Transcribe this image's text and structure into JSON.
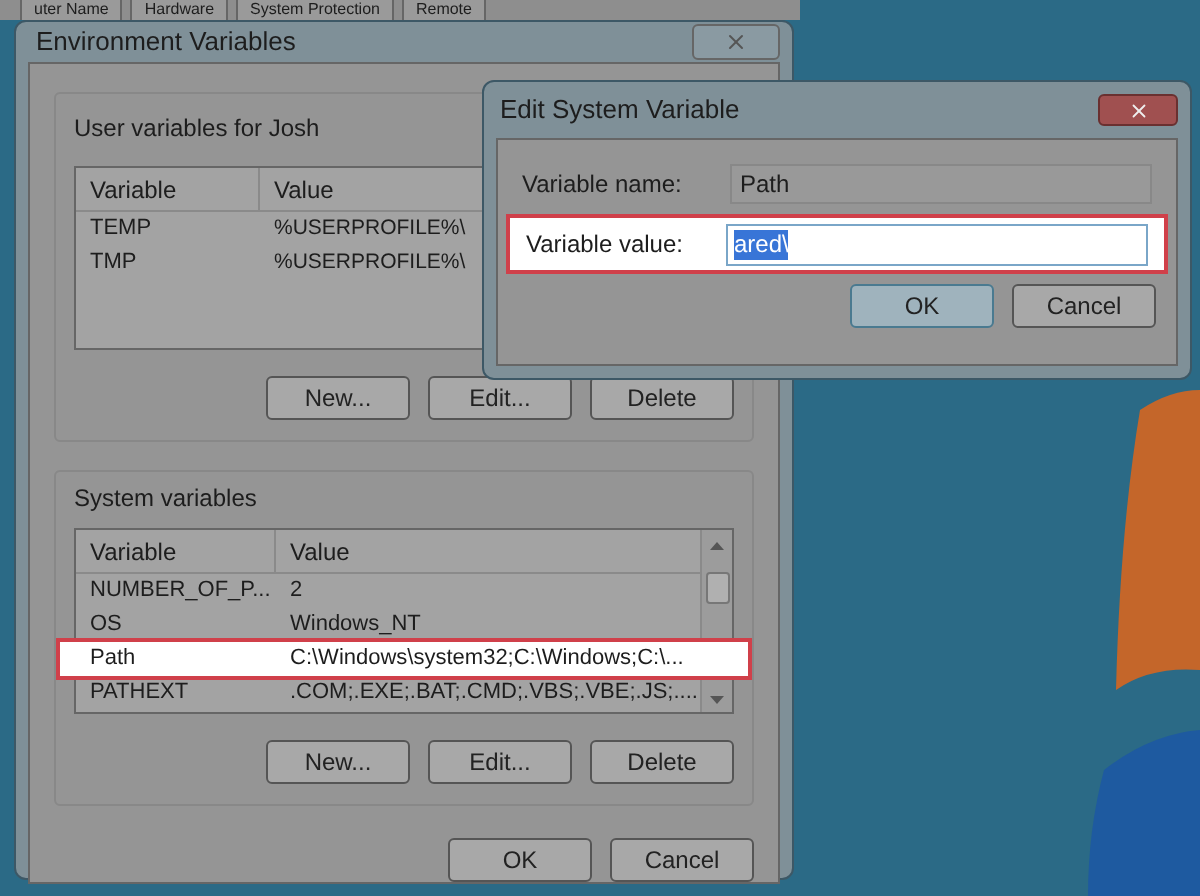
{
  "background_tabs": [
    {
      "label": "uter Name",
      "selected": false
    },
    {
      "label": "Hardware",
      "selected": false
    },
    {
      "label": "System Protection",
      "selected": false
    },
    {
      "label": "Remote",
      "selected": false
    }
  ],
  "environment_window": {
    "title": "Environment Variables",
    "user_group": {
      "label": "User variables for Josh",
      "columns": [
        "Variable",
        "Value"
      ],
      "rows": [
        {
          "variable": "TEMP",
          "value": "%USERPROFILE%\\",
          "selected": false
        },
        {
          "variable": "TMP",
          "value": "%USERPROFILE%\\",
          "selected": false
        }
      ],
      "buttons": [
        "New...",
        "Edit...",
        "Delete"
      ]
    },
    "system_group": {
      "label": "System variables",
      "columns": [
        "Variable",
        "Value"
      ],
      "rows": [
        {
          "variable": "NUMBER_OF_P...",
          "value": "2",
          "selected": false
        },
        {
          "variable": "OS",
          "value": "Windows_NT",
          "selected": false
        },
        {
          "variable": "Path",
          "value": "C:\\Windows\\system32;C:\\Windows;C:\\...",
          "selected": true
        },
        {
          "variable": "PATHEXT",
          "value": ".COM;.EXE;.BAT;.CMD;.VBS;.VBE;.JS;....",
          "selected": false
        }
      ],
      "buttons": [
        "New...",
        "Edit...",
        "Delete"
      ]
    },
    "buttons": [
      "OK",
      "Cancel"
    ]
  },
  "edit_dialog": {
    "title": "Edit System Variable",
    "name_label": "Variable name:",
    "name_value": "Path",
    "value_label": "Variable value:",
    "value": "ared\\",
    "value_selected": true,
    "buttons": [
      "OK",
      "Cancel"
    ]
  }
}
